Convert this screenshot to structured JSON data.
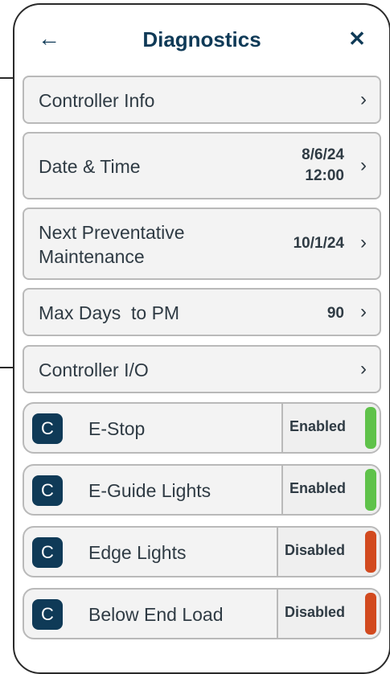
{
  "header": {
    "title": "Diagnostics",
    "back_glyph": "←",
    "close_glyph": "✕"
  },
  "rows": [
    {
      "label": "Controller Info",
      "value": "",
      "chevron": "›"
    },
    {
      "label": "Date & Time",
      "value_line1": "8/6/24",
      "value_line2": "12:00",
      "chevron": "›"
    },
    {
      "label_line1": "Next Preventative",
      "label_line2": "Maintenance",
      "value": "10/1/24",
      "chevron": "›"
    },
    {
      "label": "Max Days  to PM",
      "value": "90",
      "chevron": "›"
    },
    {
      "label": "Controller I/O",
      "value": "",
      "chevron": "›"
    }
  ],
  "toggles": [
    {
      "badge": "C",
      "label": "E-Stop",
      "state": "Enabled",
      "color": "#5fc24a"
    },
    {
      "badge": "C",
      "label": "E-Guide Lights",
      "state": "Enabled",
      "color": "#5fc24a"
    },
    {
      "badge": "C",
      "label": "Edge Lights",
      "state": "Disabled",
      "color": "#d24a1f"
    },
    {
      "badge": "C",
      "label": "Below End Load",
      "state": "Disabled",
      "color": "#d24a1f"
    }
  ],
  "colors": {
    "brand": "#0f3a57",
    "enabled": "#5fc24a",
    "disabled": "#d24a1f"
  }
}
